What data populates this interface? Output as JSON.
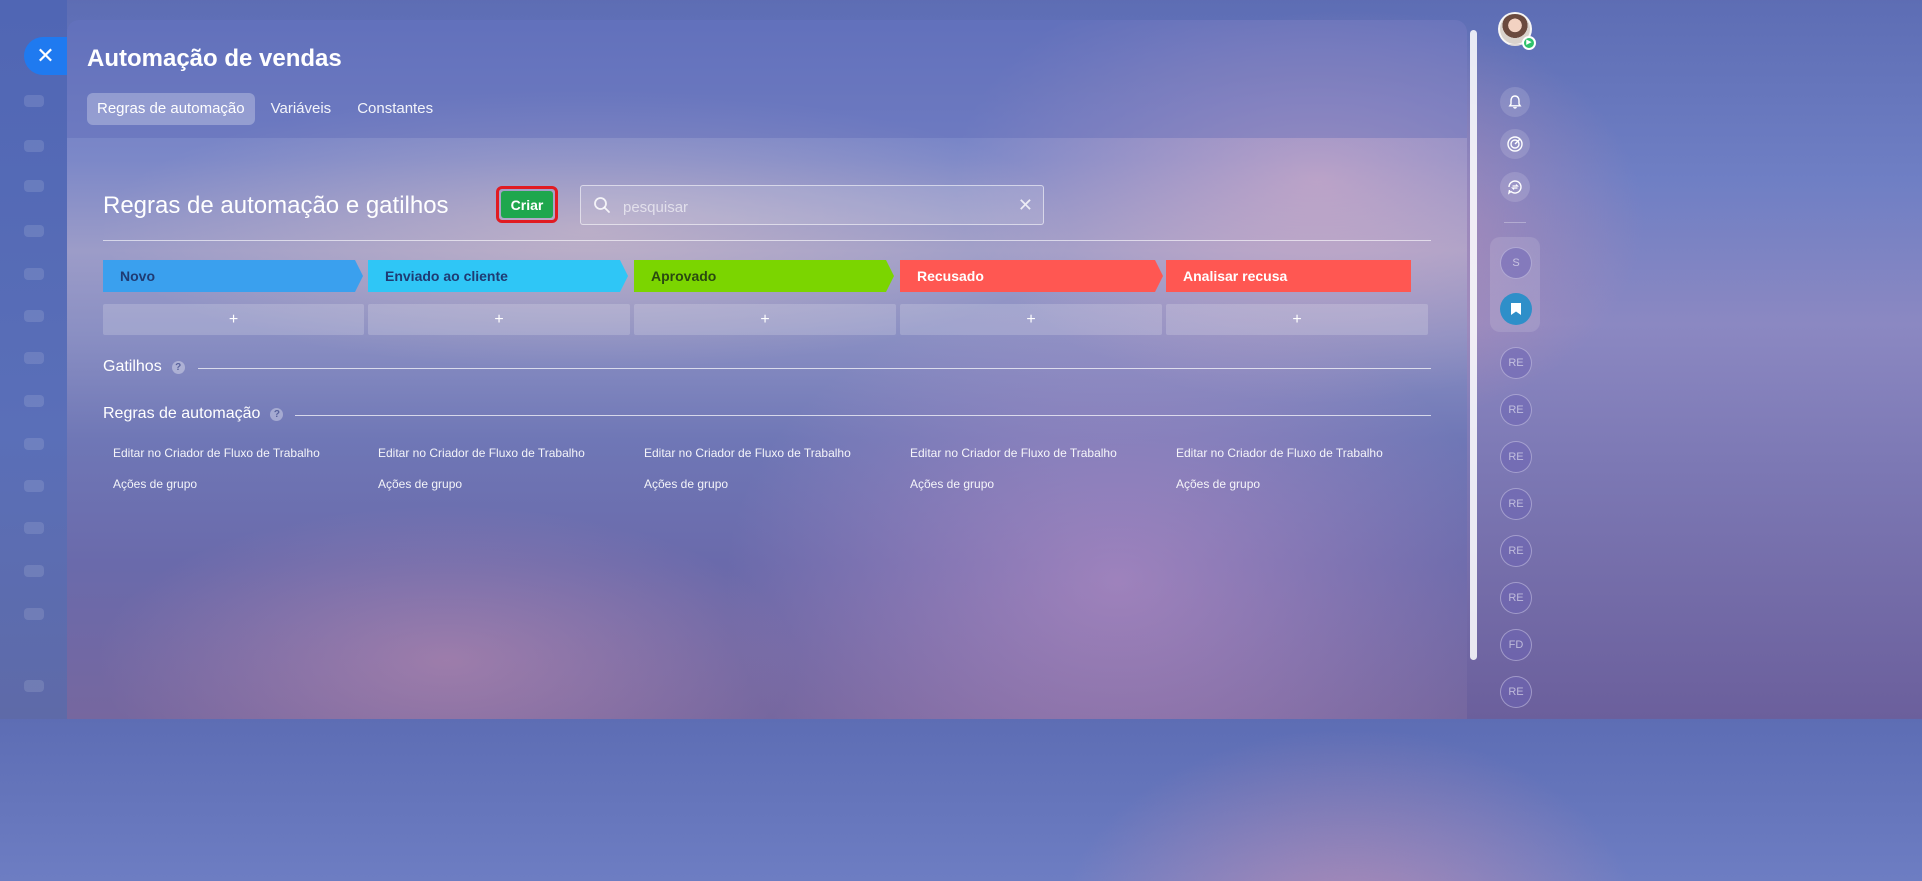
{
  "panel": {
    "title": "Automação de vendas",
    "tabs": [
      {
        "label": "Regras de automação",
        "active": true
      },
      {
        "label": "Variáveis",
        "active": false
      },
      {
        "label": "Constantes",
        "active": false
      }
    ]
  },
  "header": {
    "title": "Regras de automação e gatilhos",
    "create_label": "Criar",
    "search_placeholder": "pesquisar"
  },
  "stages": [
    {
      "label": "Novo",
      "color": "#3aa0ee"
    },
    {
      "label": "Enviado ao cliente",
      "color": "#2fc6f6"
    },
    {
      "label": "Aprovado",
      "color": "#7bd500"
    },
    {
      "label": "Recusado",
      "color": "#ff5752"
    },
    {
      "label": "Analisar recusa",
      "color": "#ff5752"
    }
  ],
  "add_label": "+",
  "triggers": {
    "label": "Gatilhos",
    "help": "?"
  },
  "rules": {
    "label": "Regras de automação",
    "help": "?"
  },
  "column_links": {
    "edit": "Editar no Criador de Fluxo de Trabalho",
    "group": "Ações de grupo"
  },
  "rail": {
    "chips": [
      "S",
      "RE",
      "RE",
      "RE",
      "RE",
      "RE",
      "RE",
      "FD",
      "RE"
    ]
  },
  "icons": [
    "close-icon",
    "search-icon",
    "clear-icon",
    "bell-icon",
    "radar-icon",
    "sync-chat-icon",
    "bookmark-icon",
    "help-icon"
  ]
}
